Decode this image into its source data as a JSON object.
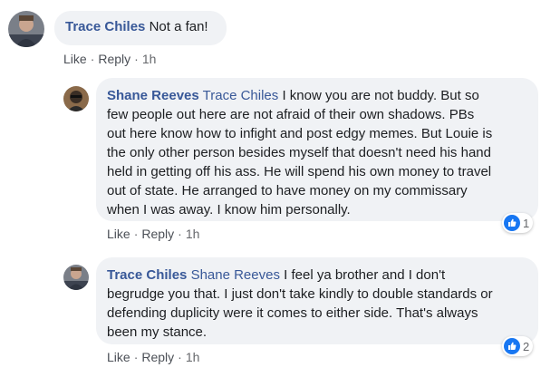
{
  "comments": [
    {
      "author": "Trace Chiles",
      "mention": "",
      "text": "Not a fan!",
      "actions": {
        "like": "Like",
        "reply": "Reply",
        "time": "1h"
      }
    },
    {
      "author": "Shane Reeves",
      "mention": "Trace Chiles",
      "lines": [
        "I know you are not buddy. But so",
        "few people out here are not afraid of their own shadows. PBs",
        "out here know how to infight and post edgy memes. But Louie is",
        "the only other person besides myself that doesn't need his hand",
        "held in getting off his ass. He will spend his own money to travel",
        "out of state. He arranged to have money on my commissary",
        "when I was away. I know him personally."
      ],
      "reactions": {
        "icon": "like-icon",
        "count": "1"
      },
      "actions": {
        "like": "Like",
        "reply": "Reply",
        "time": "1h"
      }
    },
    {
      "author": "Trace Chiles",
      "mention": "Shane Reeves",
      "lines": [
        "I feel ya brother and I don't",
        "begrudge you that. I just don't take kindly to double standards or",
        "defending duplicity were it comes to either side. That's always",
        "been my stance."
      ],
      "reactions": {
        "icon": "like-icon",
        "count": "2"
      },
      "actions": {
        "like": "Like",
        "reply": "Reply",
        "time": "1h"
      }
    }
  ],
  "colors": {
    "link": "#385898",
    "bubble": "#f0f2f5",
    "like_blue": "#1877f2"
  }
}
